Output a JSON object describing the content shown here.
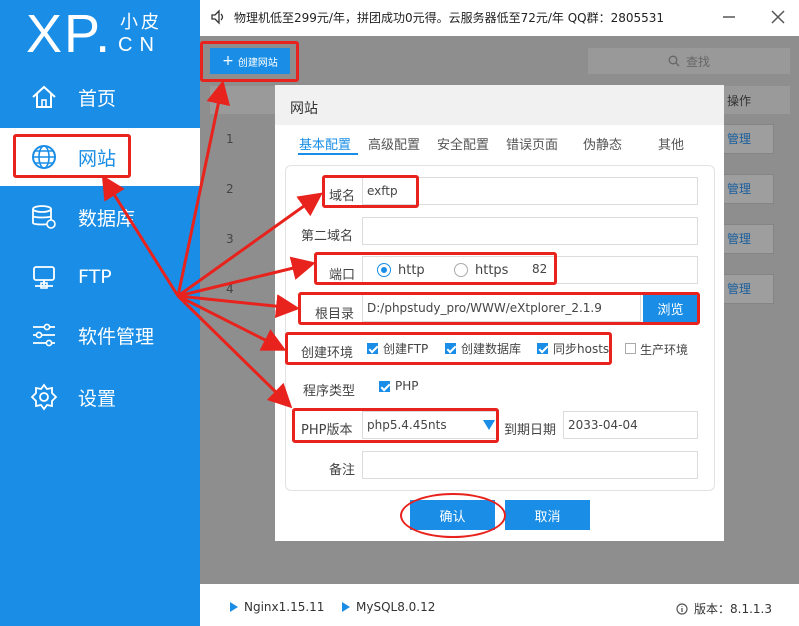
{
  "logo": {
    "main": "XP.",
    "sub1": "小皮",
    "sub2": "CN"
  },
  "sidebar": {
    "items": [
      {
        "label": "首页",
        "icon": "home-icon"
      },
      {
        "label": "网站",
        "icon": "globe-icon",
        "active": true
      },
      {
        "label": "数据库",
        "icon": "database-icon"
      },
      {
        "label": "FTP",
        "icon": "ftp-icon"
      },
      {
        "label": "软件管理",
        "icon": "sliders-icon"
      },
      {
        "label": "设置",
        "icon": "gear-icon"
      }
    ]
  },
  "notice": {
    "text": "物理机低至299元/年，拼团成功0元得。云服务器低至72元/年  QQ群：2805531",
    "icon": "speaker-icon"
  },
  "toolbar": {
    "create_site": "创建网站",
    "search": "查找"
  },
  "table": {
    "op_header": "操作",
    "rows": [
      "1",
      "2",
      "3",
      "4"
    ],
    "manage_label": "管理"
  },
  "dialog": {
    "title": "网站",
    "tabs": [
      "基本配置",
      "高级配置",
      "安全配置",
      "错误页面",
      "伪静态",
      "其他"
    ],
    "active_tab": "基本配置",
    "domain": {
      "label": "域名",
      "value": "exftp"
    },
    "second_domain": {
      "label": "第二域名",
      "value": ""
    },
    "port": {
      "label": "端口",
      "http": "http",
      "https": "https",
      "value": "82",
      "selected": "http"
    },
    "root": {
      "label": "根目录",
      "value": "D:/phpstudy_pro/WWW/eXtplorer_2.1.9",
      "browse": "浏览"
    },
    "env": {
      "label": "创建环境",
      "options": [
        {
          "label": "创建FTP",
          "checked": true
        },
        {
          "label": "创建数据库",
          "checked": true
        },
        {
          "label": "同步hosts",
          "checked": true
        },
        {
          "label": "生产环境",
          "checked": false
        }
      ]
    },
    "program": {
      "label": "程序类型",
      "option": "PHP",
      "checked": true
    },
    "php": {
      "label": "PHP版本",
      "value": "php5.4.45nts"
    },
    "expire": {
      "label": "到期日期",
      "value": "2033-04-04"
    },
    "remark": {
      "label": "备注",
      "value": ""
    },
    "confirm": "确认",
    "cancel": "取消"
  },
  "footer": {
    "nginx": "Nginx1.15.11",
    "mysql": "MySQL8.0.12",
    "version": "版本：8.1.1.3"
  },
  "colors": {
    "accent": "#1a8ee6",
    "annotation": "#e8221c"
  }
}
